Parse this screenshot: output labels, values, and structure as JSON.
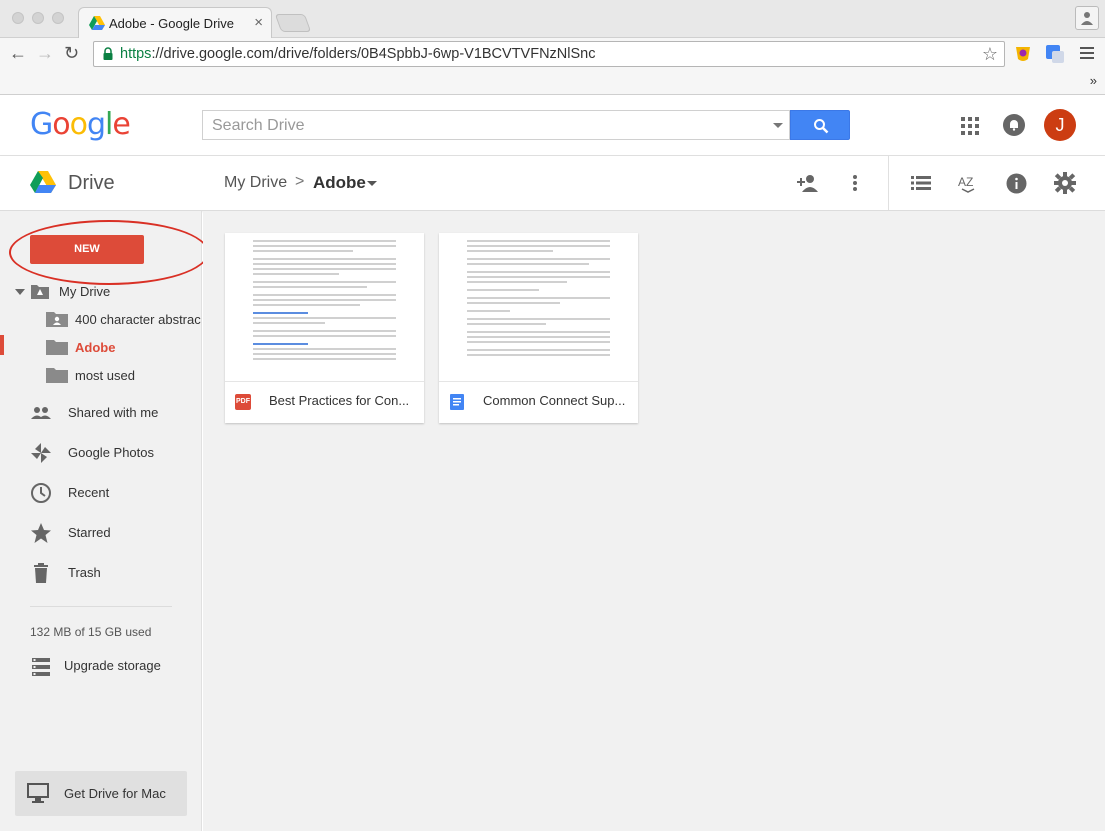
{
  "browser": {
    "tab_title": "Adobe - Google Drive",
    "tab_close": "×",
    "url_secure": "https",
    "url_rest": "://drive.google.com/drive/folders/0B4SpbbJ-6wp-V1BCVTVFNzNlSnc",
    "bookmarks_chevron": "»"
  },
  "header": {
    "logo": "Google",
    "search_placeholder": "Search Drive",
    "avatar_letter": "J"
  },
  "drive_header": {
    "title": "Drive",
    "breadcrumb_root": "My Drive",
    "breadcrumb_sep": ">",
    "breadcrumb_current": "Adobe"
  },
  "sidebar": {
    "new_label": "NEW",
    "tree": [
      {
        "label": "My Drive"
      },
      {
        "label": "400 character abstrac"
      },
      {
        "label": "Adobe"
      },
      {
        "label": "most used"
      }
    ],
    "items": [
      {
        "label": "Shared with me"
      },
      {
        "label": "Google Photos"
      },
      {
        "label": "Recent"
      },
      {
        "label": "Starred"
      },
      {
        "label": "Trash"
      }
    ],
    "quota": "132 MB of 15 GB used",
    "upgrade": "Upgrade storage",
    "get_drive": "Get Drive for Mac"
  },
  "files": [
    {
      "name": "Best Practices for Con...",
      "type": "pdf",
      "type_badge": "PDF"
    },
    {
      "name": "Common Connect Sup...",
      "type": "doc"
    }
  ],
  "colors": {
    "accent_red": "#dd4b39",
    "search_blue": "#4285f4",
    "avatar": "#cc3d12"
  }
}
